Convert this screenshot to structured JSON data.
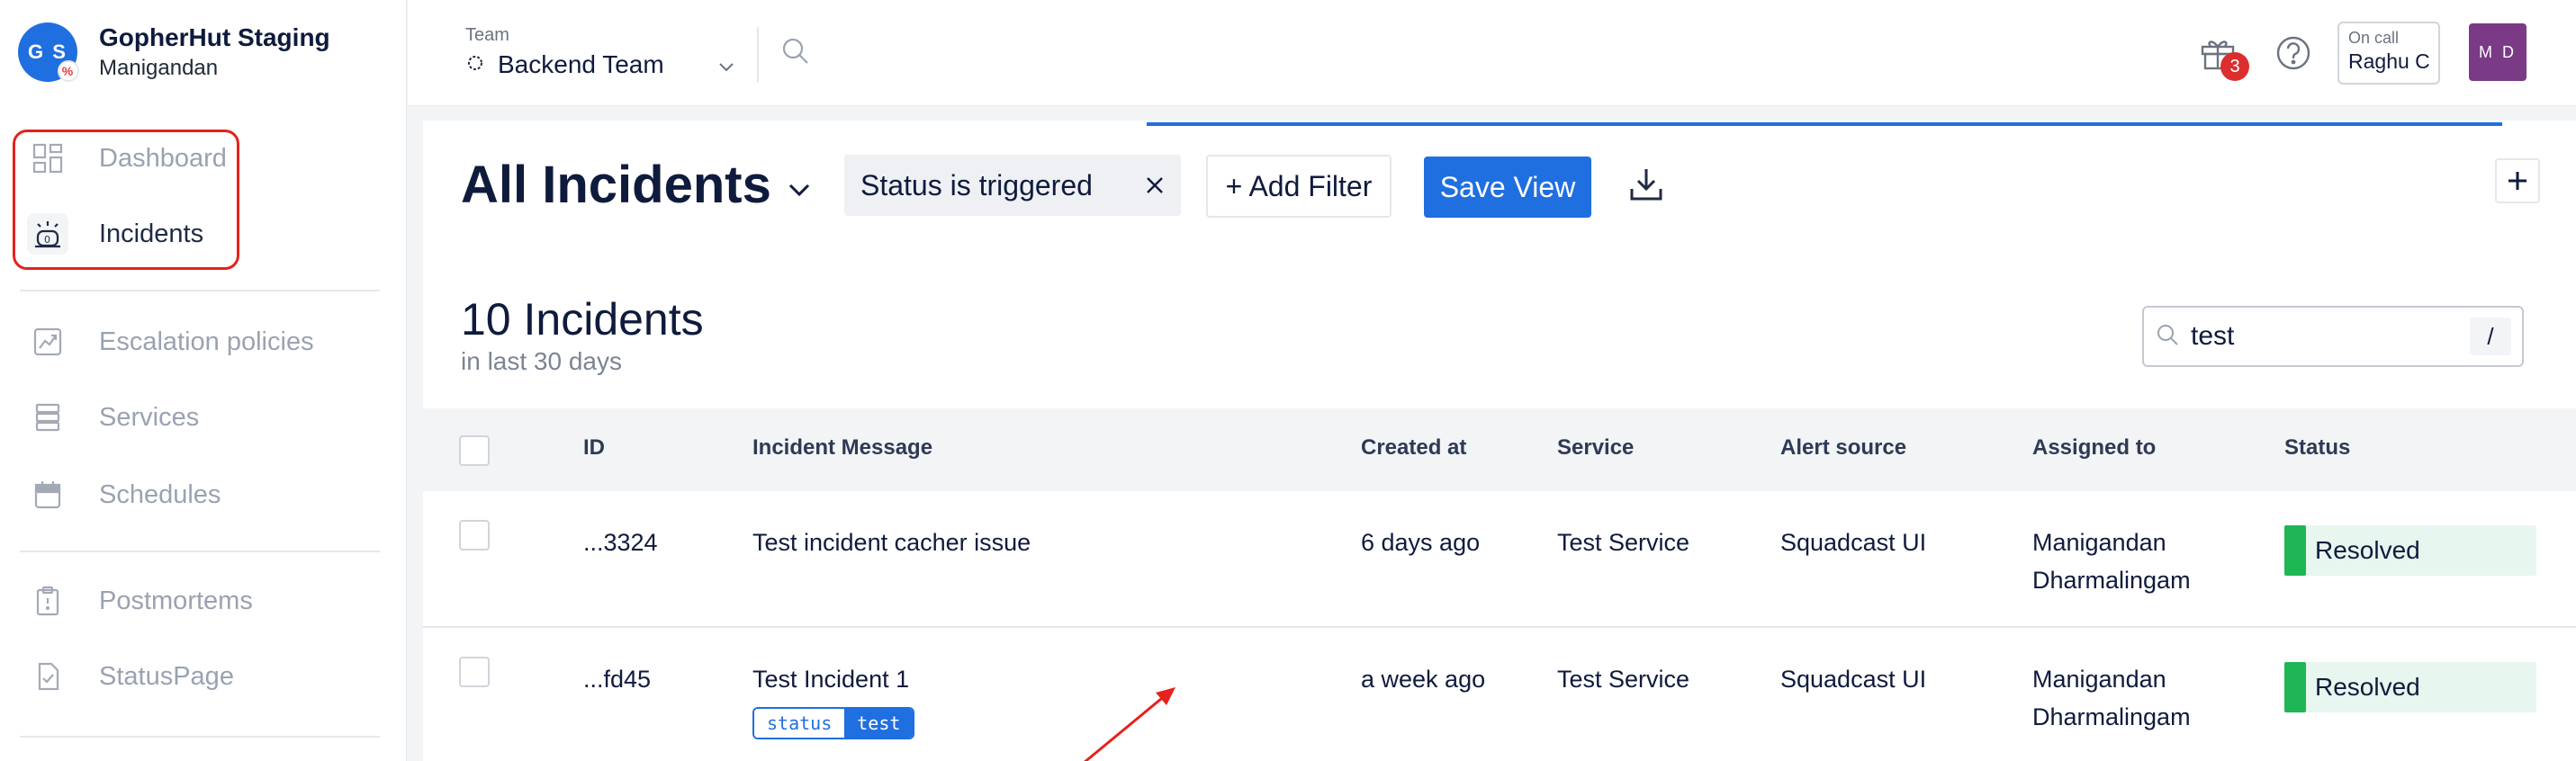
{
  "org": {
    "initials": "G S",
    "name": "GopherHut Staging",
    "user": "Manigandan"
  },
  "sidebar": {
    "items": [
      {
        "label": "Dashboard",
        "icon": "dashboard-icon"
      },
      {
        "label": "Incidents",
        "icon": "incidents-icon",
        "active": true
      },
      {
        "label": "Escalation policies",
        "icon": "escalation-icon"
      },
      {
        "label": "Services",
        "icon": "services-icon"
      },
      {
        "label": "Schedules",
        "icon": "calendar-icon"
      },
      {
        "label": "Postmortems",
        "icon": "clipboard-icon"
      },
      {
        "label": "StatusPage",
        "icon": "statuspage-icon"
      }
    ]
  },
  "header": {
    "team_label": "Team",
    "team_value": "Backend Team",
    "gift_count": "3",
    "oncall_label": "On call",
    "oncall_name": "Raghu C",
    "avatar_initials": "M D"
  },
  "view": {
    "title": "All Incidents",
    "filter_chip": "Status is triggered",
    "add_filter": "+ Add Filter",
    "save_view": "Save View",
    "plus": "+"
  },
  "summary": {
    "count": "10 Incidents",
    "period": "in last 30 days"
  },
  "search": {
    "value": "test",
    "shortcut": "/"
  },
  "table": {
    "columns": [
      "ID",
      "Incident Message",
      "Created at",
      "Service",
      "Alert source",
      "Assigned to",
      "Status"
    ],
    "rows": [
      {
        "id": "...3324",
        "message": "Test incident cacher issue",
        "created": "6 days ago",
        "service": "Test Service",
        "source": "Squadcast UI",
        "assigned_line1": "Manigandan",
        "assigned_line2": "Dharmalingam",
        "status": "Resolved"
      },
      {
        "id": "...fd45",
        "message": "Test Incident 1",
        "tag_key": "status",
        "tag_value": "test",
        "created": "a week ago",
        "service": "Test Service",
        "source": "Squadcast UI",
        "assigned_line1": "Manigandan",
        "assigned_line2": "Dharmalingam",
        "status": "Resolved"
      }
    ]
  },
  "colors": {
    "accent": "#1f6fe0",
    "resolved": "#1fb655",
    "highlight": "#e5221b",
    "badge": "#dc2e2e"
  }
}
